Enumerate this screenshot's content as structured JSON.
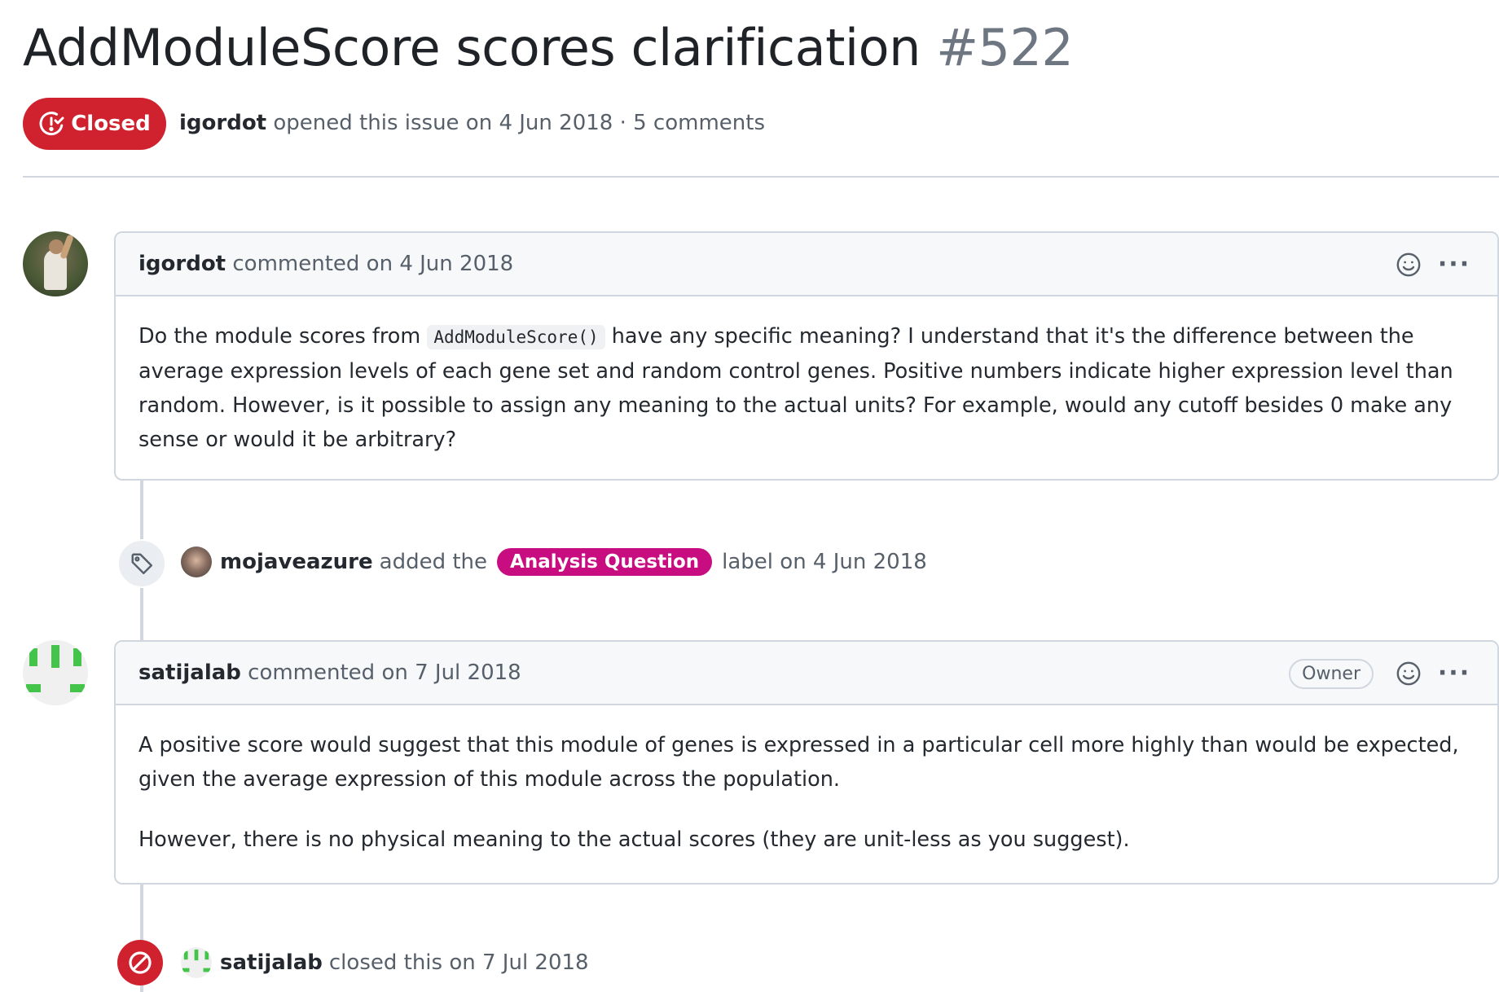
{
  "issue": {
    "title": "AddModuleScore scores clarification",
    "number": "#522",
    "state": "Closed",
    "author": "igordot",
    "opened_text": "opened this issue on 4 Jun 2018 · 5 comments"
  },
  "comments": [
    {
      "author": "igordot",
      "action": "commented on 4 Jun 2018",
      "body": {
        "part1": "Do the module scores from ",
        "code": "AddModuleScore()",
        "part2": " have any specific meaning? I understand that it's the difference between the average expression levels of each gene set and random control genes. Positive numbers indicate higher expression level than random. However, is it possible to assign any meaning to the actual units? For example, would any cutoff besides 0 make any sense or would it be arbitrary?"
      }
    },
    {
      "author": "satijalab",
      "action": "commented on 7 Jul 2018",
      "badge": "Owner",
      "paragraphs": [
        "A positive score would suggest that this module of genes is expressed in a particular cell more highly than would be expected, given the average expression of this module across the population.",
        "However, there is no physical meaning to the actual scores (they are unit-less as you suggest)."
      ]
    }
  ],
  "events": {
    "label_event": {
      "actor": "mojaveazure",
      "pre": "added the",
      "label": "Analysis Question",
      "post": "label on 4 Jun 2018",
      "label_color": "#c80d80"
    },
    "close_event": {
      "actor": "satijalab",
      "text": "closed this on 7 Jul 2018"
    }
  },
  "icons": [
    "issue-closed-icon",
    "smiley-icon",
    "kebab-icon",
    "tag-icon",
    "circle-slash-icon"
  ],
  "colors": {
    "closed_red": "#cf222e",
    "label_magenta": "#c80d80",
    "identicon_green": "#44c44a"
  }
}
